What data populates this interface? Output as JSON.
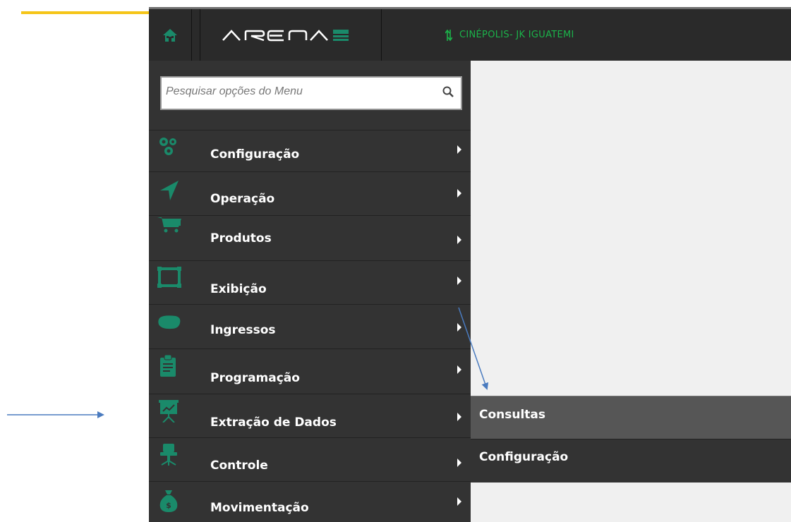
{
  "header": {
    "logo_text": "ARENA",
    "location": "CINÉPOLIS- JK IGUATEMI"
  },
  "search": {
    "placeholder": "Pesquisar opções do Menu",
    "value": ""
  },
  "menu": {
    "items": [
      {
        "label": "Configuração",
        "icon": "gears-icon"
      },
      {
        "label": "Operação",
        "icon": "navigation-arrow-icon"
      },
      {
        "label": "Produtos",
        "icon": "cart-icon"
      },
      {
        "label": "Exibição",
        "icon": "screen-frame-icon"
      },
      {
        "label": "Ingressos",
        "icon": "ticket-icon"
      },
      {
        "label": "Programação",
        "icon": "clipboard-icon"
      },
      {
        "label": "Extração de Dados",
        "icon": "presentation-chart-icon"
      },
      {
        "label": "Controle",
        "icon": "office-chair-icon"
      },
      {
        "label": "Movimentação",
        "icon": "money-bag-icon"
      }
    ]
  },
  "submenu": {
    "items": [
      {
        "label": "Consultas"
      },
      {
        "label": "Configuração"
      }
    ]
  },
  "colors": {
    "accent_green": "#1a8a6a",
    "location_green": "#1bb34a",
    "highlight_yellow": "#f5c518",
    "annotation_blue": "#4a7bbf"
  }
}
